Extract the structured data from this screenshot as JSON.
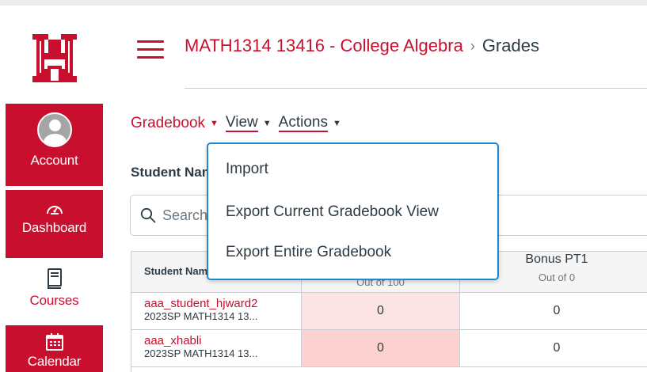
{
  "nav": {
    "logo_text": "UH",
    "items": [
      {
        "label": "Account",
        "icon": "user-avatar-icon"
      },
      {
        "label": "Dashboard",
        "icon": "dashboard-gauge-icon"
      },
      {
        "label": "Courses",
        "icon": "courses-book-icon"
      },
      {
        "label": "Calendar",
        "icon": "calendar-icon"
      }
    ]
  },
  "header": {
    "course": "MATH1314 13416 - College Algebra",
    "separator": "›",
    "page": "Grades"
  },
  "gradebook": {
    "menus": [
      {
        "label": "Gradebook"
      },
      {
        "label": "View"
      },
      {
        "label": "Actions"
      }
    ],
    "student_names_label": "Student Names",
    "search_placeholder": "Search Students"
  },
  "actions_menu": {
    "items": [
      "Import",
      "Export Current Gradebook View",
      "Export Entire Gradebook"
    ]
  },
  "grid": {
    "columns": [
      {
        "title": "Student Name",
        "subtitle": ""
      },
      {
        "title": "",
        "subtitle": "Out of 100"
      },
      {
        "title": "Bonus PT1",
        "subtitle": "Out of 0"
      }
    ],
    "rows": [
      {
        "name": "aaa_student_hjward2",
        "section": "2023SP MATH1314 13...",
        "score": "0",
        "bonus": "0"
      },
      {
        "name": "aaa_xhabli",
        "section": "2023SP MATH1314 13...",
        "score": "0",
        "bonus": "0"
      }
    ]
  },
  "colors": {
    "brand_red": "#c8102e",
    "focus_blue": "#1b8ad0",
    "score_highlight_1": "#fde4e4",
    "score_highlight_2": "#fbd2d0"
  }
}
